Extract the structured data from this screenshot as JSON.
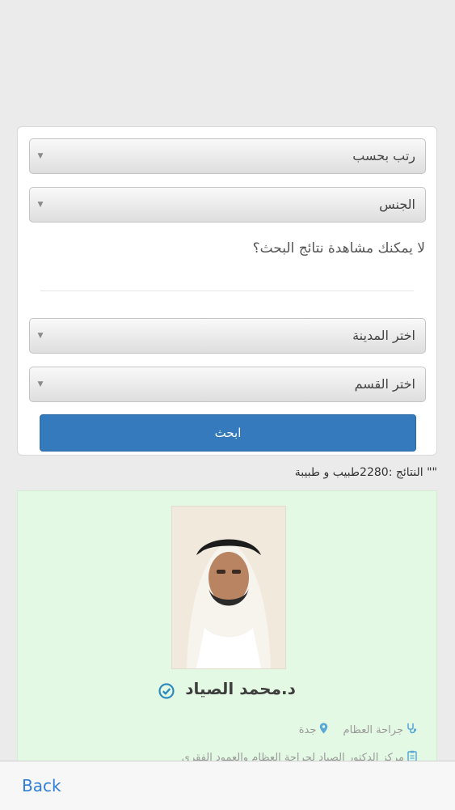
{
  "filters": {
    "sort_by": "رتب بحسب",
    "gender": "الجنس",
    "hint": "لا يمكنك مشاهدة نتائج البحث؟",
    "city": "اختر المدينة",
    "department": "اختر القسم",
    "search_button": "ابحث"
  },
  "results": {
    "summary": "\"\"  النتائج :2280طبيب و طبيبة"
  },
  "doctor": {
    "name": "د.محمد الصياد",
    "specialty": "جراحة العظام",
    "city": "جدة",
    "clinic": "مركز الدكتور الصياد لجراحة العظام والعمود الفقري"
  },
  "nav": {
    "back_label": "Back"
  },
  "colors": {
    "accent": "#357abd",
    "card_bg": "#e3f9e3",
    "verified": "#2e8bc0",
    "link": "#2f7ed8"
  },
  "icons": [
    "chevron-down-icon",
    "verified-check-icon",
    "stethoscope-icon",
    "location-pin-icon",
    "clipboard-icon"
  ]
}
